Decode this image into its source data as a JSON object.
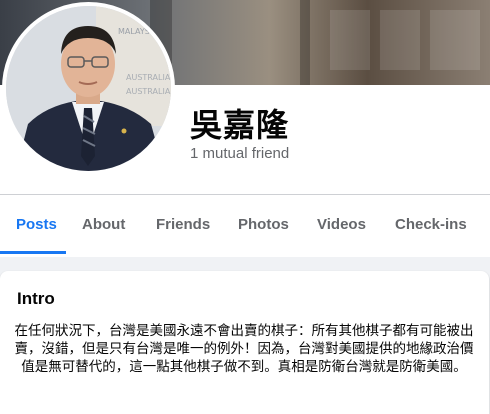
{
  "profile": {
    "name": "吳嘉隆",
    "mutual_friends": "1 mutual friend",
    "cover_sign_text": "MALAYSIA"
  },
  "tabs": [
    {
      "label": "Posts",
      "active": true
    },
    {
      "label": "About",
      "active": false
    },
    {
      "label": "Friends",
      "active": false
    },
    {
      "label": "Photos",
      "active": false
    },
    {
      "label": "Videos",
      "active": false
    },
    {
      "label": "Check-ins",
      "active": false
    }
  ],
  "intro": {
    "title": "Intro",
    "bio": "在任何狀況下，台灣是美國永遠不會出賣的棋子：所有其他棋子都有可能被出賣，沒錯，但是只有台灣是唯一的例外！因為，台灣對美國提供的地緣政治價值是無可替代的，這一點其他棋子做不到。真相是防衛台灣就是防衛美國。"
  },
  "colors": {
    "accent": "#1877f2",
    "secondary_text": "#65676b",
    "page_bg": "#f0f2f5"
  }
}
